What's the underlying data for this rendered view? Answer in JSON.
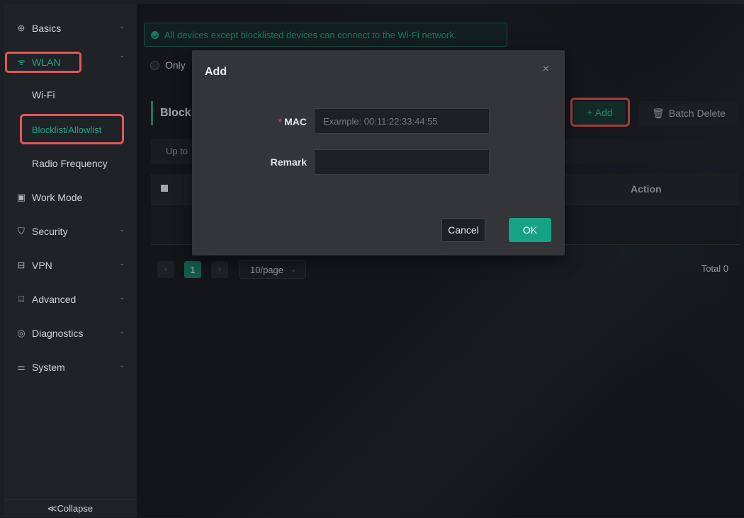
{
  "sidebar": {
    "items": [
      {
        "label": "Basics",
        "icon": "globe-icon"
      },
      {
        "label": "WLAN",
        "icon": "wifi-icon"
      },
      {
        "label": "Work Mode",
        "icon": "mode-icon"
      },
      {
        "label": "Security",
        "icon": "shield-icon"
      },
      {
        "label": "VPN",
        "icon": "vpn-icon"
      },
      {
        "label": "Advanced",
        "icon": "briefcase-icon"
      },
      {
        "label": "Diagnostics",
        "icon": "diagnostics-icon"
      },
      {
        "label": "System",
        "icon": "sliders-icon"
      }
    ],
    "wlan_sub": [
      "Wi-Fi",
      "Blocklist/Allowlist",
      "Radio Frequency"
    ],
    "collapse_label": "≪Collapse"
  },
  "main": {
    "notice": "All devices except blocklisted devices can connect to the Wi-Fi network.",
    "radio_label": "Only",
    "section_title": "Block",
    "add_label": "+ Add",
    "batch_delete_label": "Batch Delete",
    "tip_text": "Up to",
    "action_header": "Action",
    "pager": {
      "current": "1",
      "page_size": "10/page",
      "total": "Total 0"
    }
  },
  "modal": {
    "title": "Add",
    "close": "×",
    "mac_label": "MAC",
    "mac_placeholder": "Example: 00:11:22:33:44:55",
    "remark_label": "Remark",
    "remark_value": "",
    "cancel_label": "Cancel",
    "ok_label": "OK"
  },
  "colors": {
    "accent": "#19a98a",
    "highlight": "#e45757",
    "ok_button": "#17a287"
  }
}
